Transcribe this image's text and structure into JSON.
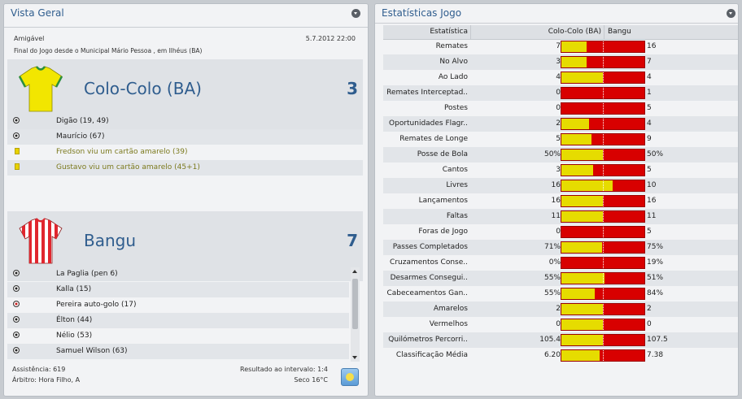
{
  "left_panel": {
    "title": "Vista Geral",
    "competition": "Amigável",
    "datetime": "5.7.2012 22:00",
    "venue": "Final do Jogo desde o Municipal Mário Pessoa , em Ilhéus (BA)",
    "home": {
      "name": "Colo-Colo (BA)",
      "score": "3",
      "shirt_colors": [
        "#f2e600",
        "#2a8f3e"
      ],
      "events": [
        {
          "type": "goal",
          "text": "Digão (19, 49)"
        },
        {
          "type": "goal",
          "text": "Maurício (67)"
        },
        {
          "type": "yellow-card",
          "text": "Fredson viu um cartão amarelo (39)"
        },
        {
          "type": "yellow-card",
          "text": "Gustavo viu um cartão amarelo (45+1)"
        }
      ]
    },
    "away": {
      "name": "Bangu",
      "score": "7",
      "shirt_colors": [
        "#e0262e",
        "#ffffff"
      ],
      "events": [
        {
          "type": "goal",
          "text": "La Paglia (pen 6)"
        },
        {
          "type": "goal",
          "text": "Kalla (15)"
        },
        {
          "type": "own-goal",
          "text": "Pereira auto-golo (17)"
        },
        {
          "type": "goal",
          "text": "Élton (44)"
        },
        {
          "type": "goal",
          "text": "Nélio (53)"
        },
        {
          "type": "goal",
          "text": "Samuel Wilson (63)"
        }
      ]
    },
    "attendance": "Assistência: 619",
    "referee": "Árbitro: Hora Filho, A",
    "halftime": "Resultado ao intervalo: 1:4",
    "weather": "Seco 16°C",
    "weather_icon": "sun-icon"
  },
  "right_panel": {
    "title": "Estatísticas Jogo",
    "col_stat": "Estatística",
    "col_home": "Colo-Colo (BA)",
    "col_away": "Bangu",
    "colors": {
      "home": "#e6dc00",
      "away": "#d80000"
    },
    "stats": [
      {
        "label": "Remates",
        "home": "7",
        "away": "16",
        "share": 0.3
      },
      {
        "label": "No Alvo",
        "home": "3",
        "away": "7",
        "share": 0.3
      },
      {
        "label": "Ao Lado",
        "home": "4",
        "away": "4",
        "share": 0.5
      },
      {
        "label": "Remates Interceptad..",
        "home": "0",
        "away": "1",
        "share": 0.0
      },
      {
        "label": "Postes",
        "home": "0",
        "away": "5",
        "share": 0.0
      },
      {
        "label": "Oportunidades Flagr..",
        "home": "2",
        "away": "4",
        "share": 0.33
      },
      {
        "label": "Remates de Longe",
        "home": "5",
        "away": "9",
        "share": 0.36
      },
      {
        "label": "Posse de Bola",
        "home": "50%",
        "away": "50%",
        "share": 0.5
      },
      {
        "label": "Cantos",
        "home": "3",
        "away": "5",
        "share": 0.38
      },
      {
        "label": "Livres",
        "home": "16",
        "away": "10",
        "share": 0.62
      },
      {
        "label": "Lançamentos",
        "home": "16",
        "away": "16",
        "share": 0.5
      },
      {
        "label": "Faltas",
        "home": "11",
        "away": "11",
        "share": 0.5
      },
      {
        "label": "Foras de Jogo",
        "home": "0",
        "away": "5",
        "share": 0.0
      },
      {
        "label": "Passes Completados",
        "home": "71%",
        "away": "75%",
        "share": 0.49
      },
      {
        "label": "Cruzamentos Conse..",
        "home": "0%",
        "away": "19%",
        "share": 0.0
      },
      {
        "label": "Desarmes Consegui..",
        "home": "55%",
        "away": "51%",
        "share": 0.52
      },
      {
        "label": "Cabeceamentos Gan..",
        "home": "55%",
        "away": "84%",
        "share": 0.4
      },
      {
        "label": "Amarelos",
        "home": "2",
        "away": "2",
        "share": 0.5
      },
      {
        "label": "Vermelhos",
        "home": "0",
        "away": "0",
        "share": 0.5
      },
      {
        "label": "Quilómetros Percorri..",
        "home": "105.4",
        "away": "107.5",
        "share": 0.5
      },
      {
        "label": "Classificação Média",
        "home": "6.20",
        "away": "7.38",
        "share": 0.46
      }
    ]
  }
}
